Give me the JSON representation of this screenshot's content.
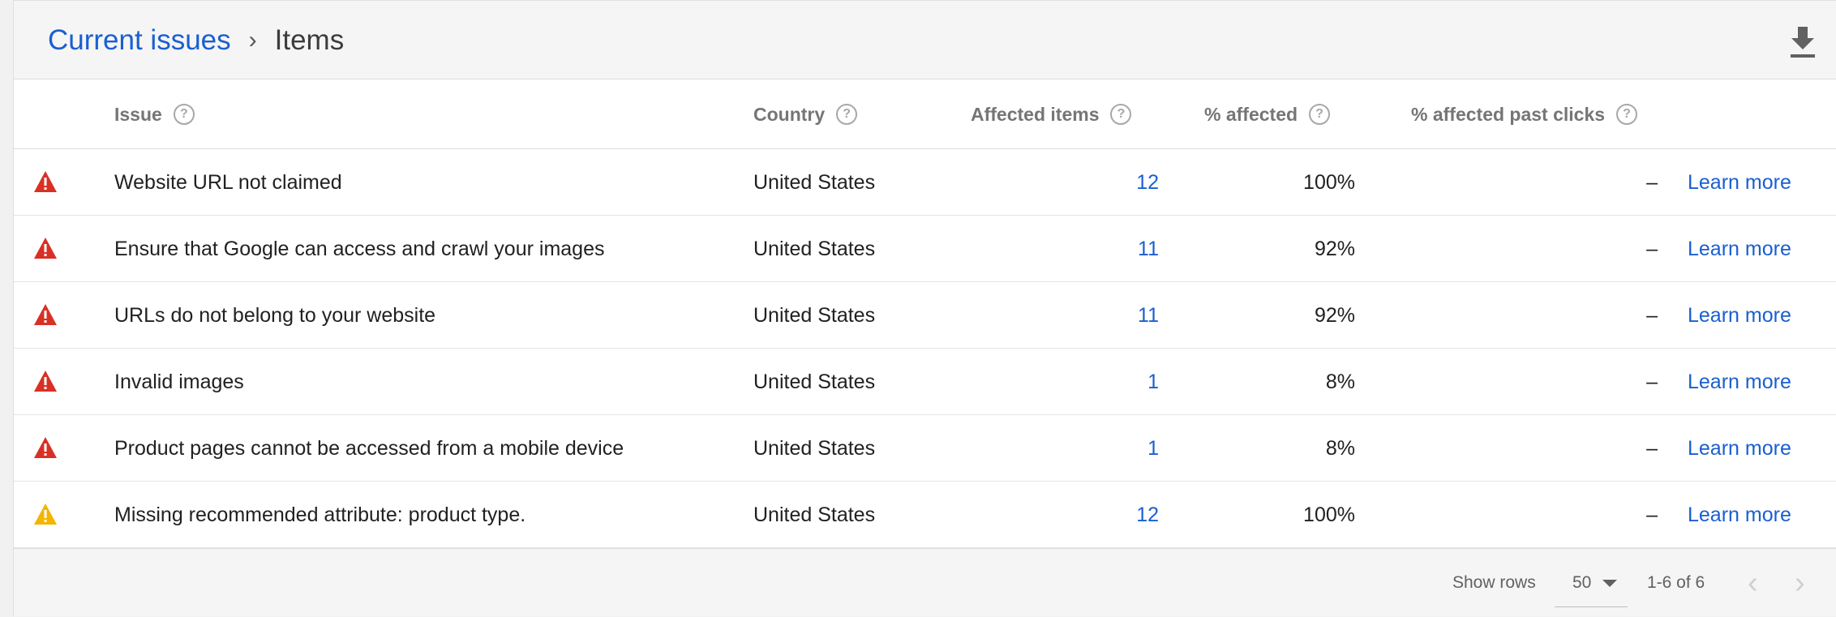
{
  "breadcrumb": {
    "parent": "Current issues",
    "separator": "›",
    "current": "Items"
  },
  "header_actions": {
    "download_icon": "download-icon"
  },
  "columns": {
    "issue": "Issue",
    "country": "Country",
    "affected_items": "Affected items",
    "pct_affected": "% affected",
    "pct_affected_clicks": "% affected past clicks",
    "help_glyph": "?"
  },
  "rows": [
    {
      "severity": "error",
      "issue": "Website URL not claimed",
      "country": "United States",
      "affected_items": "12",
      "pct_affected": "100%",
      "pct_clicks": "–",
      "link": "Learn more"
    },
    {
      "severity": "error",
      "issue": "Ensure that Google can access and crawl your images",
      "country": "United States",
      "affected_items": "11",
      "pct_affected": "92%",
      "pct_clicks": "–",
      "link": "Learn more"
    },
    {
      "severity": "error",
      "issue": "URLs do not belong to your website",
      "country": "United States",
      "affected_items": "11",
      "pct_affected": "92%",
      "pct_clicks": "–",
      "link": "Learn more"
    },
    {
      "severity": "error",
      "issue": "Invalid images",
      "country": "United States",
      "affected_items": "1",
      "pct_affected": "8%",
      "pct_clicks": "–",
      "link": "Learn more"
    },
    {
      "severity": "error",
      "issue": "Product pages cannot be accessed from a mobile device",
      "country": "United States",
      "affected_items": "1",
      "pct_affected": "8%",
      "pct_clicks": "–",
      "link": "Learn more"
    },
    {
      "severity": "warning",
      "issue": "Missing recommended attribute: product type.",
      "country": "United States",
      "affected_items": "12",
      "pct_affected": "100%",
      "pct_clicks": "–",
      "link": "Learn more"
    }
  ],
  "colors": {
    "error": "#d93025",
    "warning": "#f4b400",
    "link": "#1a5fd0"
  },
  "footer": {
    "show_rows_label": "Show rows",
    "rows_value": "50",
    "range": "1-6 of 6",
    "prev_glyph": "‹",
    "next_glyph": "›"
  }
}
